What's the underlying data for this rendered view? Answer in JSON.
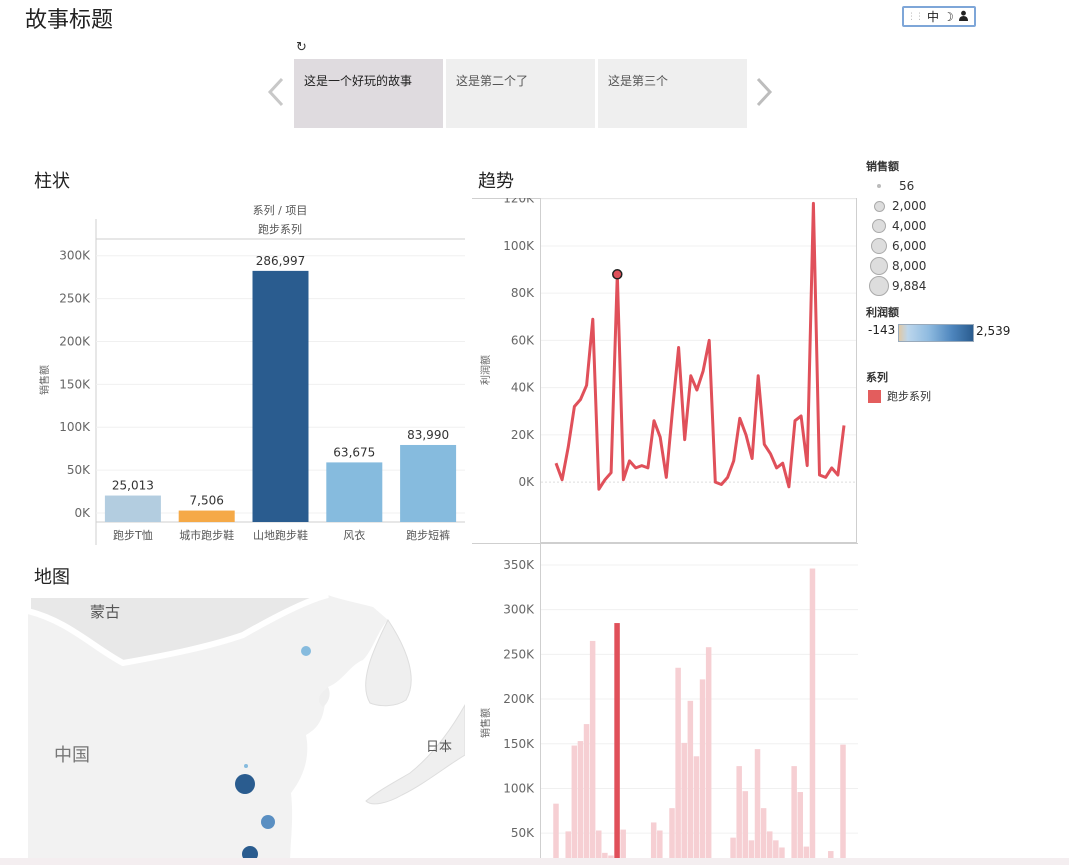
{
  "story": {
    "title": "故事标题",
    "revert_icon": "revert-icon",
    "points": [
      "这是一个好玩的故事",
      "这是第二个了",
      "这是第三个"
    ],
    "prev_icon": "chevron-left-icon",
    "next_icon": "chevron-right-icon"
  },
  "toolbar": {
    "ime_label": "中",
    "moon_icon": "moon-icon",
    "user_icon": "user-icon"
  },
  "sheets": {
    "bar_title": "柱状",
    "trend_title": "趋势",
    "map_title": "地图"
  },
  "bar_chart": {
    "header_top": "系列 / 项目",
    "header_sub": "跑步系列",
    "ylabel": "销售额"
  },
  "map": {
    "labels": [
      "蒙古",
      "中国",
      "日本"
    ]
  },
  "legends": {
    "size_title": "销售额",
    "size_items": [
      "56",
      "2,000",
      "4,000",
      "6,000",
      "8,000",
      "9,884"
    ],
    "color_title": "利润额",
    "color_min": "-143",
    "color_max": "2,539",
    "series_title": "系列",
    "series_item": "跑步系列",
    "series_color": "#e35d5d"
  },
  "colors": {
    "dark_blue": "#2a5c8f",
    "light_blue": "#86bbde",
    "pale_blue": "#b3cde0",
    "orange": "#f5a947",
    "red": "#e0505a",
    "pink": "#f6cfd3"
  },
  "chart_data": [
    {
      "type": "bar",
      "title": "柱状",
      "categories": [
        "跑步T恤",
        "城市跑步鞋",
        "山地跑步鞋",
        "风衣",
        "跑步短裤"
      ],
      "values": [
        25013,
        7506,
        286997,
        63675,
        83990
      ],
      "value_labels": [
        "25,013",
        "7,506",
        "286,997",
        "63,675",
        "83,990"
      ],
      "ylabel": "销售额",
      "yticks": [
        "0K",
        "50K",
        "100K",
        "150K",
        "200K",
        "250K",
        "300K"
      ],
      "ylim": [
        0,
        330000
      ]
    },
    {
      "type": "line",
      "title": "趋势",
      "ylabel": "利润额",
      "yticks": [
        "0K",
        "20K",
        "40K",
        "60K",
        "80K",
        "100K",
        "120K"
      ],
      "ylim": [
        -8000,
        122000
      ],
      "values": [
        8000,
        1000,
        15000,
        32000,
        35000,
        41000,
        69000,
        -3000,
        1000,
        4000,
        88000,
        1000,
        9000,
        6000,
        7000,
        6000,
        26000,
        19000,
        2000,
        30000,
        57000,
        18000,
        45000,
        39000,
        47000,
        60000,
        0,
        -1000,
        2000,
        9000,
        27000,
        20000,
        10000,
        45000,
        16000,
        12000,
        6000,
        8000,
        -2000,
        26000,
        28000,
        7000,
        118000,
        3000,
        2000,
        6000,
        3000,
        24000
      ],
      "highlight_index": 10
    },
    {
      "type": "bar",
      "title": "趋势-销售额",
      "ylabel": "销售额",
      "yticks": [
        "50K",
        "100K",
        "150K",
        "200K",
        "250K",
        "300K",
        "350K"
      ],
      "ylim": [
        20000,
        360000
      ],
      "values": [
        83000,
        15000,
        52000,
        148000,
        153000,
        172000,
        265000,
        53000,
        28000,
        25000,
        285000,
        54000,
        15000,
        15000,
        21000,
        15000,
        62000,
        53000,
        13000,
        78000,
        235000,
        151000,
        198000,
        136000,
        222000,
        258000,
        12000,
        13000,
        18000,
        45000,
        125000,
        97000,
        42000,
        144000,
        78000,
        52000,
        42000,
        34000,
        15000,
        125000,
        96000,
        35000,
        346000,
        20000,
        15000,
        30000,
        17000,
        149000
      ],
      "highlight_index": 10
    }
  ]
}
